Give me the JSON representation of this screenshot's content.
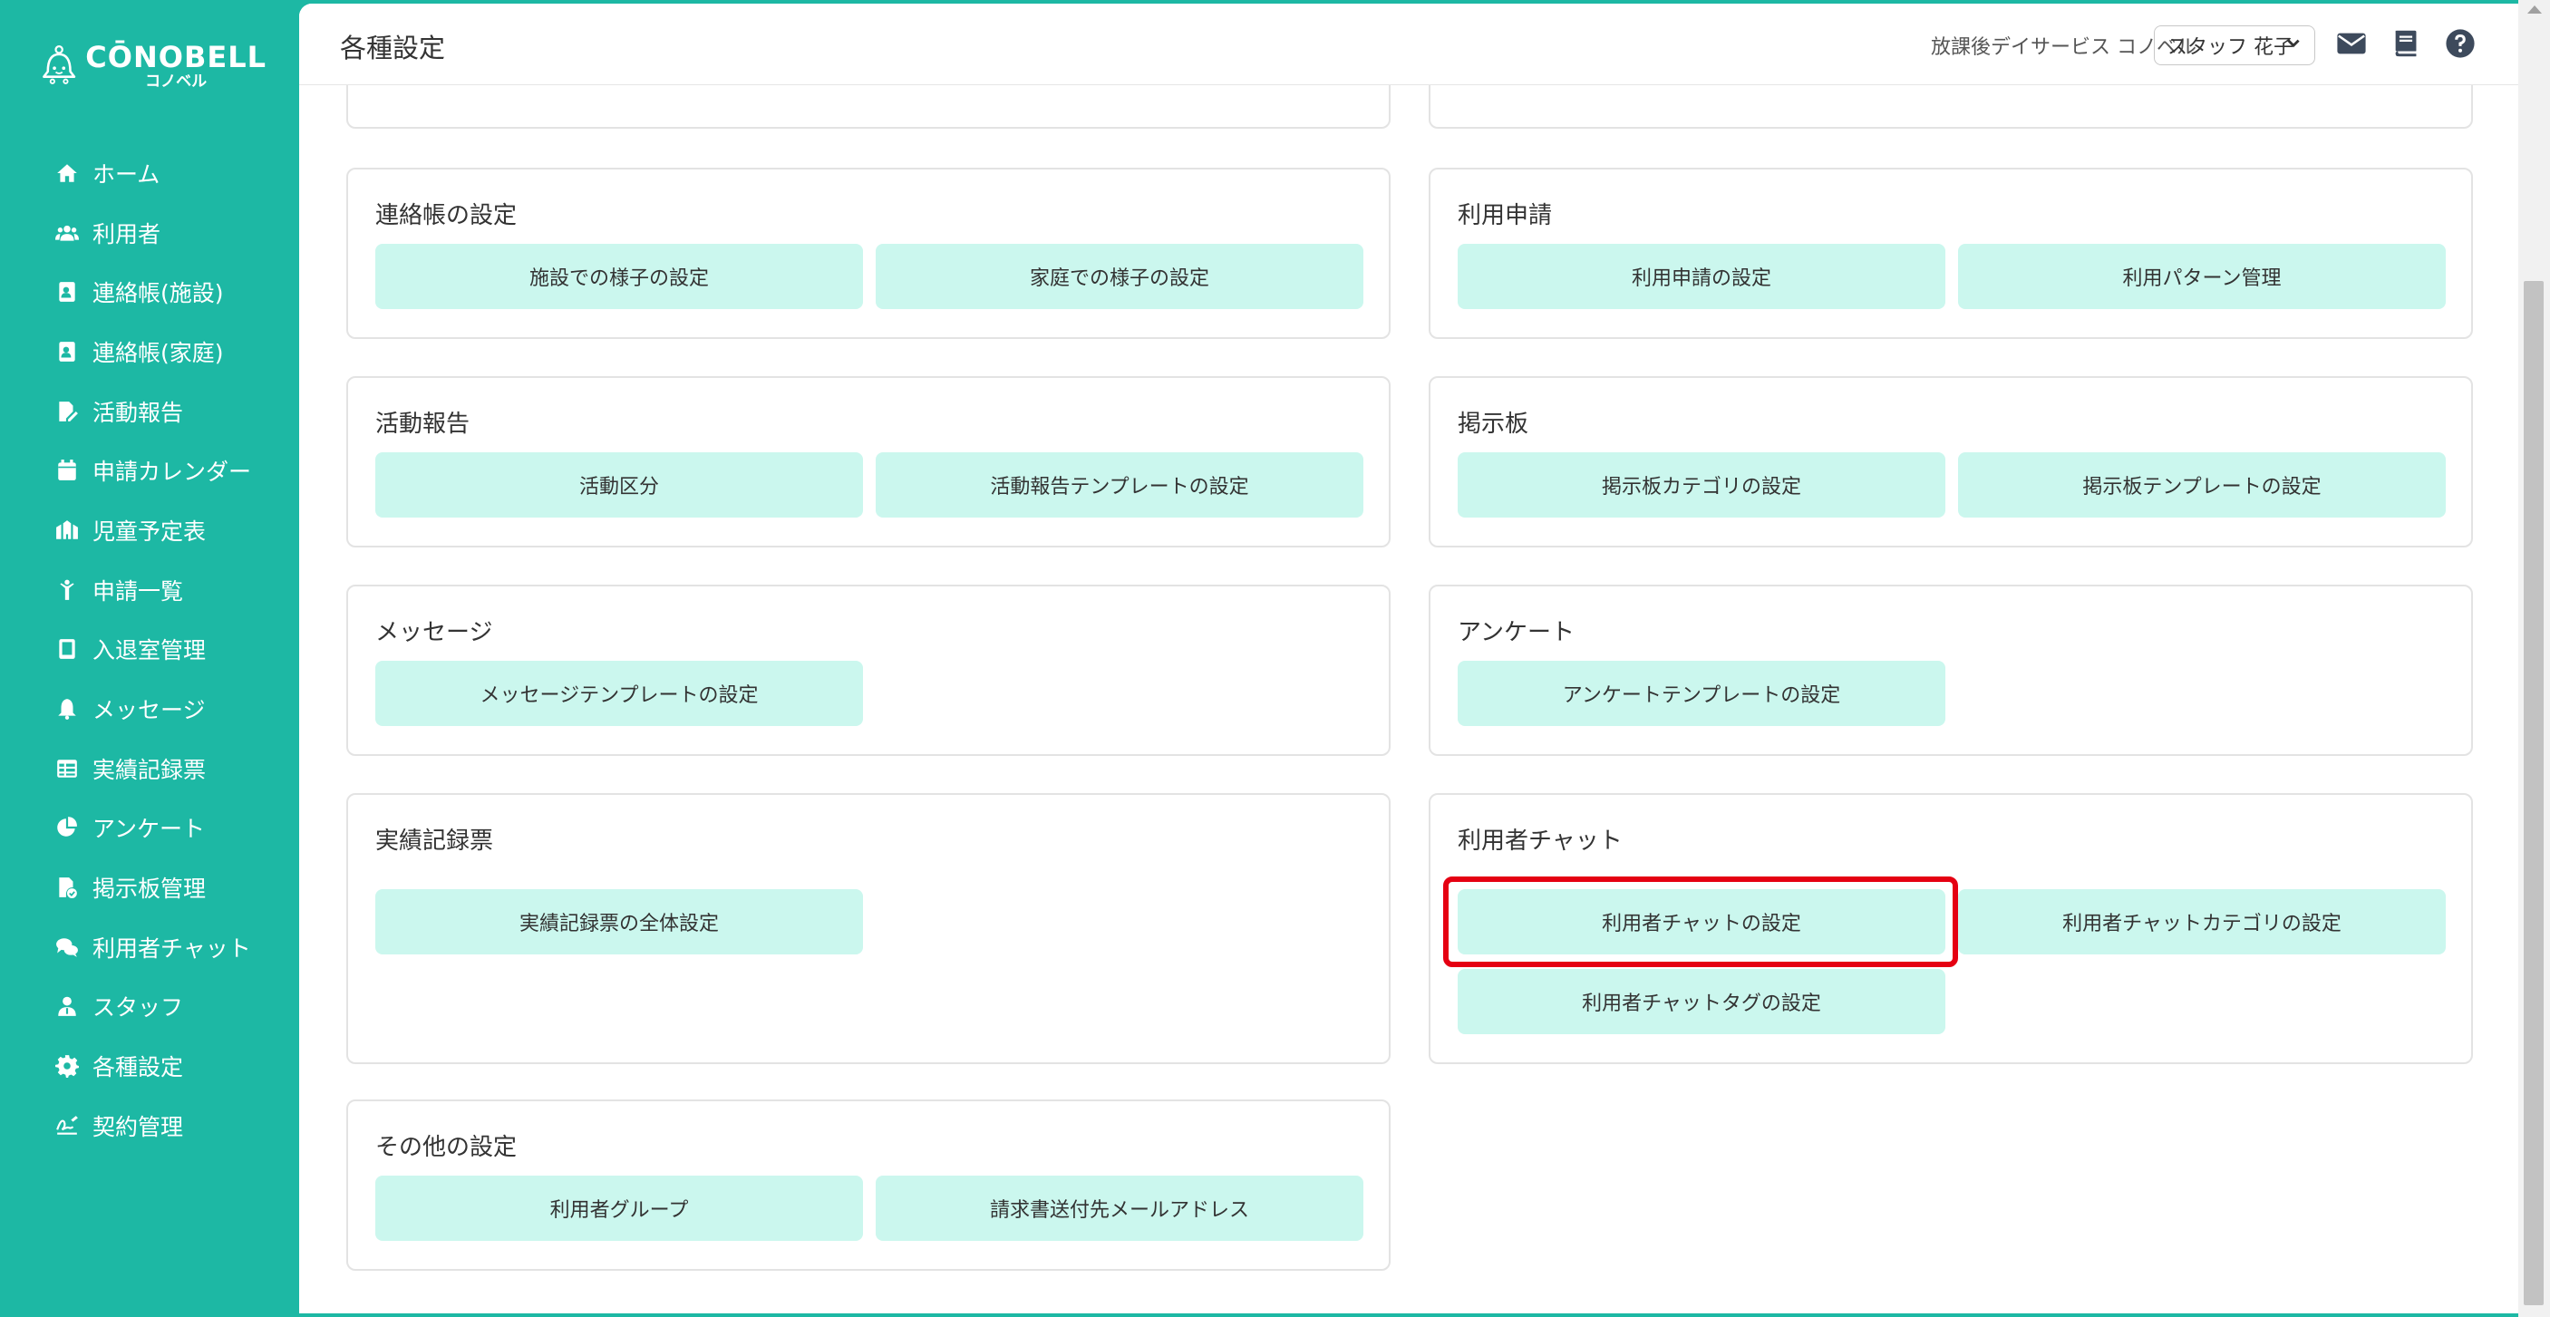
{
  "app": {
    "logo_main": "CŌNOBELL",
    "logo_sub": "コノベル"
  },
  "sidebar": {
    "items": [
      {
        "label": "ホーム",
        "icon": "home-icon"
      },
      {
        "label": "利用者",
        "icon": "users-icon"
      },
      {
        "label": "連絡帳(施設)",
        "icon": "contact-book-icon"
      },
      {
        "label": "連絡帳(家庭)",
        "icon": "contact-book-icon"
      },
      {
        "label": "活動報告",
        "icon": "file-edit-icon"
      },
      {
        "label": "申請カレンダー",
        "icon": "calendar-icon"
      },
      {
        "label": "児童予定表",
        "icon": "school-icon"
      },
      {
        "label": "申請一覧",
        "icon": "child-icon"
      },
      {
        "label": "入退室管理",
        "icon": "tablet-icon"
      },
      {
        "label": "メッセージ",
        "icon": "bell-icon"
      },
      {
        "label": "実績記録票",
        "icon": "table-icon"
      },
      {
        "label": "アンケート",
        "icon": "pie-chart-icon"
      },
      {
        "label": "掲示板管理",
        "icon": "file-check-icon"
      },
      {
        "label": "利用者チャット",
        "icon": "chat-icon"
      },
      {
        "label": "スタッフ",
        "icon": "staff-icon"
      },
      {
        "label": "各種設定",
        "icon": "gear-icon"
      },
      {
        "label": "契約管理",
        "icon": "signature-icon"
      }
    ]
  },
  "header": {
    "title": "各種設定",
    "facility": "放課後デイサービス コノベル",
    "staff": "スタッフ 花子"
  },
  "sections": {
    "renrakucho": {
      "title": "連絡帳の設定",
      "btn1": "施設での様子の設定",
      "btn2": "家庭での様子の設定"
    },
    "riyoshinsei": {
      "title": "利用申請",
      "btn1": "利用申請の設定",
      "btn2": "利用パターン管理"
    },
    "katsudo": {
      "title": "活動報告",
      "btn1": "活動区分",
      "btn2": "活動報告テンプレートの設定"
    },
    "keijiban": {
      "title": "掲示板",
      "btn1": "掲示板カテゴリの設定",
      "btn2": "掲示板テンプレートの設定"
    },
    "message": {
      "title": "メッセージ",
      "btn1": "メッセージテンプレートの設定"
    },
    "enquete": {
      "title": "アンケート",
      "btn1": "アンケートテンプレートの設定"
    },
    "jisseki": {
      "title": "実績記録票",
      "btn1": "実績記録票の全体設定"
    },
    "chat": {
      "title": "利用者チャット",
      "btn1": "利用者チャットの設定",
      "btn2": "利用者チャットカテゴリの設定",
      "btn3": "利用者チャットタグの設定"
    },
    "other": {
      "title": "その他の設定",
      "btn1": "利用者グループ",
      "btn2": "請求書送付先メールアドレス"
    }
  },
  "colors": {
    "accent": "#1db8a4",
    "button_bg": "#cbf7ee",
    "highlight": "#e50012"
  }
}
